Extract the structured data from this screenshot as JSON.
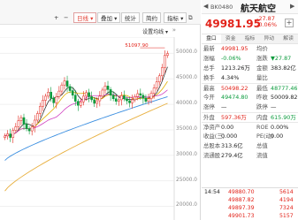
{
  "toolbar": {
    "plus": "+",
    "minus": "−",
    "period": "日线",
    "overlay": "叠加",
    "stats": "统计",
    "sim": "简约",
    "more": "指标"
  },
  "chart": {
    "settings_label": "设置均线",
    "high_marker": "51097.90",
    "yticks": [
      "50000.0",
      "45000.0",
      "40000.0",
      "35000.0",
      "30000.0",
      "25000.0",
      "20000.0"
    ]
  },
  "chart_data": {
    "type": "candlestick",
    "yrange": [
      18000,
      52500
    ],
    "yticks": [
      50000,
      45000,
      40000,
      35000,
      30000,
      25000,
      20000
    ],
    "high_label": "51097.90",
    "close_series": [
      33800,
      34200,
      33500,
      34900,
      35600,
      36800,
      37400,
      36100,
      35200,
      34800,
      35600,
      36900,
      38200,
      39600,
      40800,
      41600,
      42400,
      41200,
      40300,
      41500,
      42600,
      43800,
      44600,
      43500,
      42700,
      41800,
      40600,
      39800,
      40500,
      41600,
      42300,
      41500,
      40900,
      40200,
      40700,
      41600,
      42800,
      43600,
      42900,
      41800,
      41100,
      40600,
      40900,
      41700,
      41100,
      40700,
      40300,
      40900,
      41500,
      42100,
      41800,
      41200,
      40600,
      41100,
      42200,
      43200,
      44400,
      45600,
      47200,
      49600,
      49982
    ],
    "ma_long": [
      23000,
      40200
    ],
    "ma_mid": [
      29000,
      41500
    ]
  },
  "quote": {
    "code": "BK0480",
    "name": "航天航空",
    "price": "49981.95",
    "change": "-27.87",
    "change_pct": "-0.06%",
    "tabs": [
      "盘口",
      "资金",
      "指标",
      "异动",
      "解读"
    ],
    "rows": [
      {
        "l1": "最新",
        "v1": "49981.95",
        "l2": "均价",
        "v2": "",
        "c1": "red",
        "c2": "blk"
      },
      {
        "l1": "涨幅",
        "v1": "-0.06%",
        "l2": "涨跌",
        "v2": "▼27.87",
        "c1": "green",
        "c2": "green"
      },
      {
        "l1": "总手",
        "v1": "1213.26万",
        "l2": "金额",
        "v2": "383.82亿",
        "c1": "blk",
        "c2": "blk"
      },
      {
        "l1": "换手",
        "v1": "4.34%",
        "l2": "量比",
        "v2": "",
        "c1": "blk",
        "c2": "blk"
      },
      {
        "l1": "最高",
        "v1": "50498.22",
        "l2": "最低",
        "v2": "48777.46",
        "c1": "red",
        "c2": "green"
      },
      {
        "l1": "今开",
        "v1": "49474.80",
        "l2": "昨收",
        "v2": "50009.82",
        "c1": "green",
        "c2": "blk"
      },
      {
        "l1": "涨停",
        "v1": "—",
        "l2": "跌停",
        "v2": "—",
        "c1": "blk",
        "c2": "blk"
      },
      {
        "l1": "外盘",
        "v1": "597.36万",
        "l2": "内盘",
        "v2": "615.90万",
        "c1": "red",
        "c2": "green"
      },
      {
        "l1": "净资产",
        "v1": "0.00",
        "l2": "ROE",
        "v2": "0.00%",
        "c1": "blk",
        "c2": "blk"
      },
      {
        "l1": "收益(三)",
        "v1": "0.000",
        "l2": "PE(动)",
        "v2": "0.00",
        "c1": "blk",
        "c2": "blk"
      },
      {
        "l1": "总股本",
        "v1": "313.6亿",
        "l2": "总值",
        "v2": "",
        "c1": "blk",
        "c2": "blk"
      },
      {
        "l1": "流通股",
        "v1": "279.4亿",
        "l2": "流值",
        "v2": "",
        "c1": "blk",
        "c2": "blk"
      }
    ],
    "ticks": [
      {
        "time": "14:54",
        "price": "49880.70",
        "vol": "5614",
        "pc": "red",
        "vc": "red"
      },
      {
        "time": "",
        "price": "49887.82",
        "vol": "4194",
        "pc": "red",
        "vc": "red"
      },
      {
        "time": "",
        "price": "49897.39",
        "vol": "7324",
        "pc": "red",
        "vc": "red"
      },
      {
        "time": "",
        "price": "49901.73",
        "vol": "5157",
        "pc": "red",
        "vc": "red"
      }
    ]
  }
}
